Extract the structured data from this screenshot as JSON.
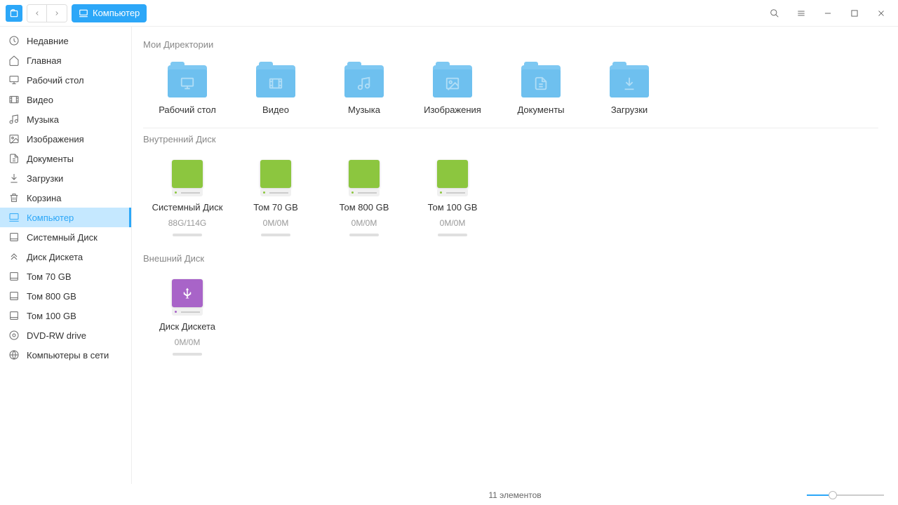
{
  "location": "Компьютер",
  "sidebar": [
    {
      "id": "recent",
      "label": "Недавние",
      "icon": "clock"
    },
    {
      "id": "home",
      "label": "Главная",
      "icon": "home"
    },
    {
      "id": "desktop",
      "label": "Рабочий стол",
      "icon": "desktop"
    },
    {
      "id": "video",
      "label": "Видео",
      "icon": "video"
    },
    {
      "id": "music",
      "label": "Музыка",
      "icon": "music"
    },
    {
      "id": "images",
      "label": "Изображения",
      "icon": "image"
    },
    {
      "id": "documents",
      "label": "Документы",
      "icon": "document"
    },
    {
      "id": "downloads",
      "label": "Загрузки",
      "icon": "download"
    },
    {
      "id": "trash",
      "label": "Корзина",
      "icon": "trash"
    },
    {
      "id": "computer",
      "label": "Компьютер",
      "icon": "computer",
      "active": true
    },
    {
      "id": "sysdisk",
      "label": "Системный Диск",
      "icon": "disk"
    },
    {
      "id": "floppy",
      "label": "Диск Дискета",
      "icon": "floppy"
    },
    {
      "id": "tom70",
      "label": "Том 70 GB",
      "icon": "disk"
    },
    {
      "id": "tom800",
      "label": "Том 800 GB",
      "icon": "disk"
    },
    {
      "id": "tom100",
      "label": "Том 100 GB",
      "icon": "disk"
    },
    {
      "id": "dvd",
      "label": "DVD-RW drive",
      "icon": "dvd"
    },
    {
      "id": "network",
      "label": "Компьютеры в сети",
      "icon": "network"
    }
  ],
  "sections": {
    "mydirs": {
      "title": "Мои Директории",
      "items": [
        {
          "label": "Рабочий стол",
          "icon": "desktop"
        },
        {
          "label": "Видео",
          "icon": "video"
        },
        {
          "label": "Музыка",
          "icon": "music"
        },
        {
          "label": "Изображения",
          "icon": "image"
        },
        {
          "label": "Документы",
          "icon": "document"
        },
        {
          "label": "Загрузки",
          "icon": "download"
        }
      ]
    },
    "internal": {
      "title": "Внутренний Диск",
      "items": [
        {
          "label": "Системный Диск",
          "sub": "88G/114G",
          "color": "green"
        },
        {
          "label": "Том 70 GB",
          "sub": "0M/0M",
          "color": "green"
        },
        {
          "label": "Том 800 GB",
          "sub": "0M/0M",
          "color": "green"
        },
        {
          "label": "Том 100 GB",
          "sub": "0M/0M",
          "color": "green"
        }
      ]
    },
    "external": {
      "title": "Внешний Диск",
      "items": [
        {
          "label": "Диск Дискета",
          "sub": "0M/0M",
          "color": "purple"
        }
      ]
    }
  },
  "status": "11 элементов"
}
